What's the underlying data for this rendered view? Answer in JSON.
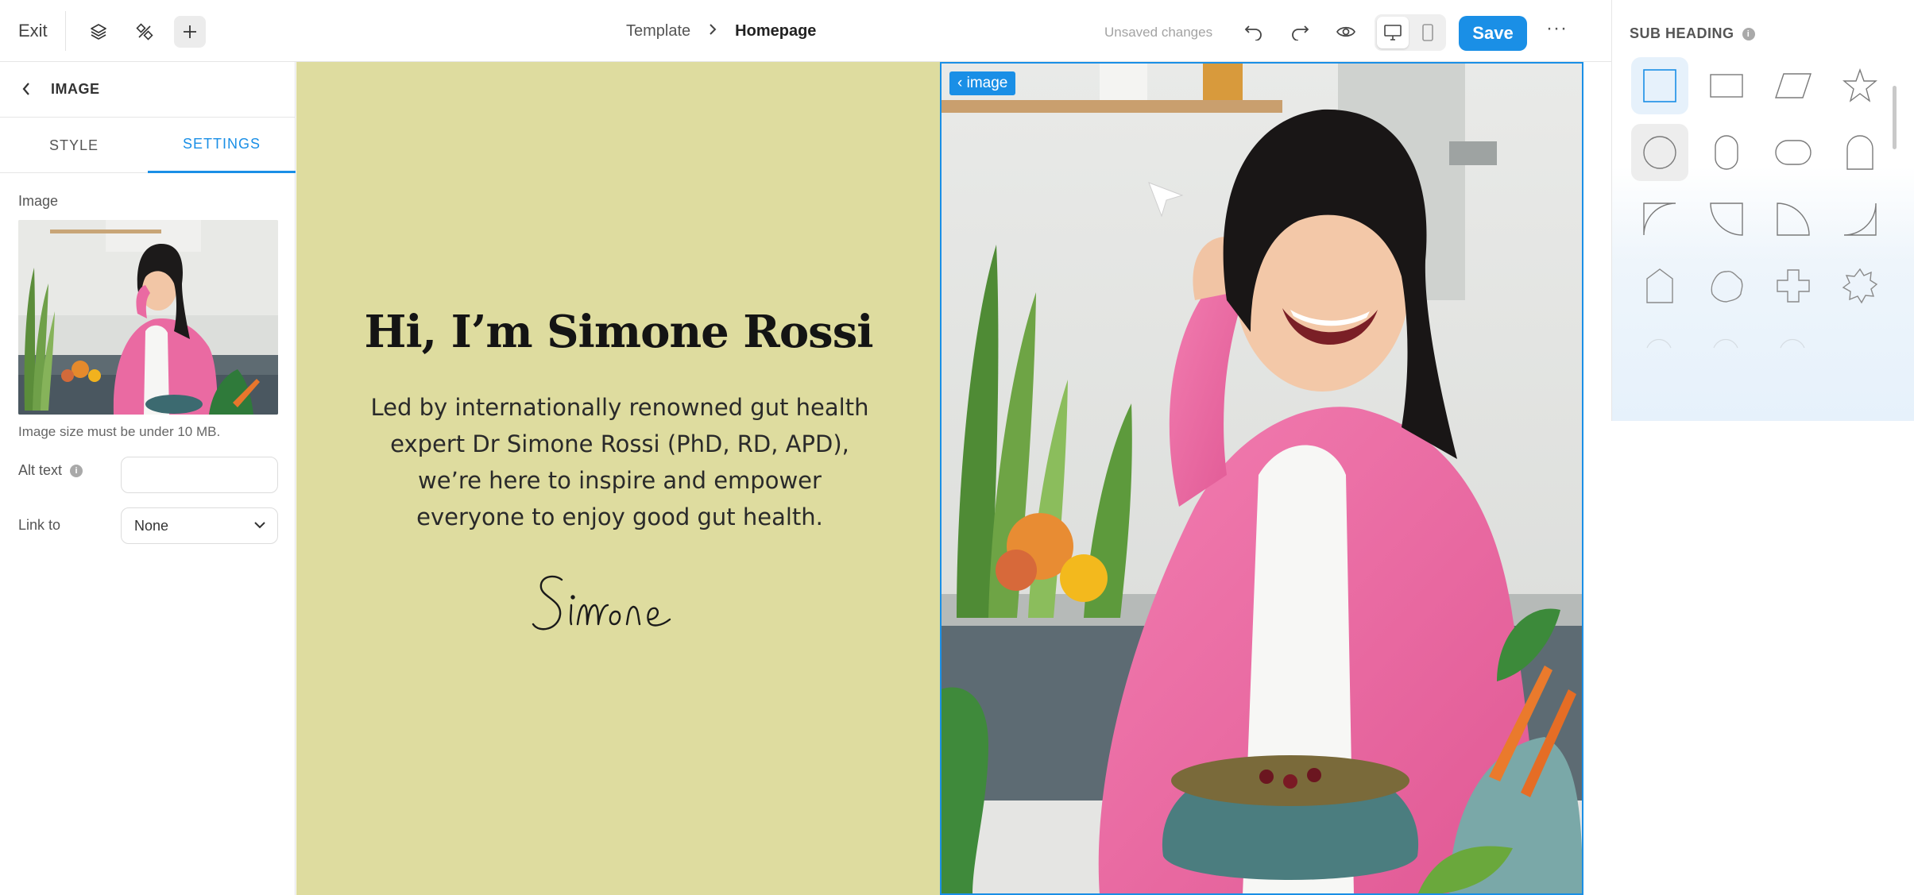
{
  "topbar": {
    "exit_label": "Exit",
    "breadcrumb": [
      "Template",
      "Homepage"
    ],
    "status_text": "Unsaved changes",
    "save_label": "Save",
    "more_label": "···"
  },
  "left_panel": {
    "back_title": "IMAGE",
    "tabs": [
      {
        "label": "STYLE",
        "active": false
      },
      {
        "label": "SETTINGS",
        "active": true
      }
    ],
    "image_label": "Image",
    "image_hint": "Image size must be under 10 MB.",
    "alt_text_label": "Alt text",
    "alt_text_value": "",
    "link_to_label": "Link to",
    "link_to_value": "None"
  },
  "canvas": {
    "heading": "Hi, I’m Simone Rossi",
    "body": "Led by internationally renowned gut health expert Dr Simone Rossi (PhD, RD, APD), we’re here to inspire and empower everyone to enjoy good gut health.",
    "signature": "Simone",
    "selected_element_tag": "image",
    "background_color": "#dedc9f"
  },
  "shape_panel": {
    "heading": "SUB HEADING",
    "shapes": [
      "square",
      "rectangle",
      "parallelogram",
      "star",
      "circle",
      "pill-vertical",
      "pill-horizontal",
      "arch",
      "quarter-top-left",
      "quarter-top-right",
      "quarter-bottom-left",
      "quarter-bottom-right",
      "tag",
      "blob",
      "cross",
      "flower"
    ]
  },
  "colors": {
    "accent": "#1a8fe6",
    "canvas_bg": "#dedc9f"
  }
}
